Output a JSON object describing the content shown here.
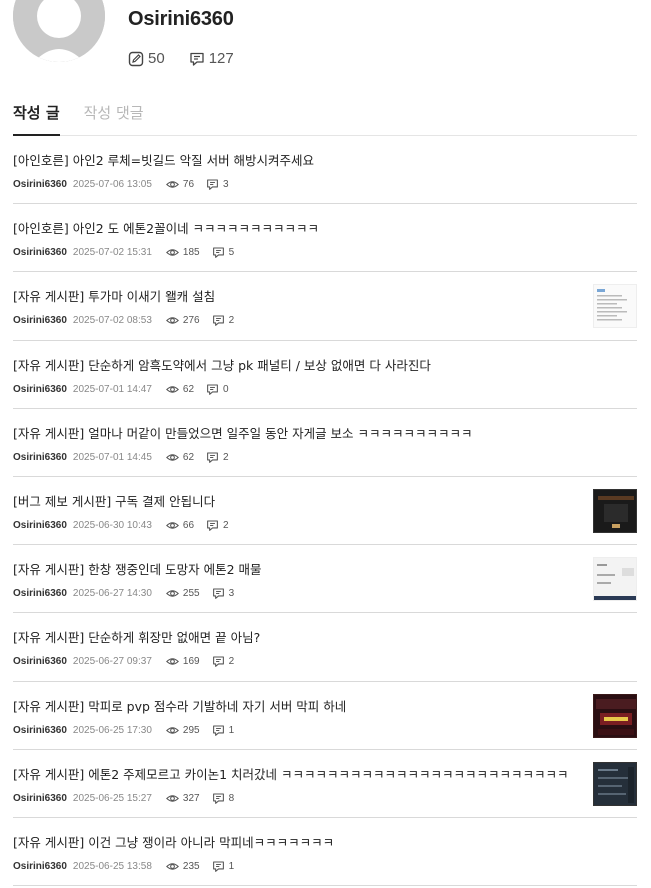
{
  "profile": {
    "username": "Osirini6360",
    "post_count": "50",
    "comment_count": "127"
  },
  "tabs": [
    {
      "label": "작성 글",
      "active": true
    },
    {
      "label": "작성 댓글",
      "active": false
    }
  ],
  "posts": [
    {
      "title": "[아인호른] 아인2 루체=빗길드 악질 서버 해방시켜주세요",
      "author": "Osirini6360",
      "date": "2025-07-06 13:05",
      "views": "76",
      "comments": "3",
      "thumb": "none"
    },
    {
      "title": "[아인호른] 아인2 도 에톤2꼴이네 ㅋㅋㅋㅋㅋㅋㅋㅋㅋㅋㅋ",
      "author": "Osirini6360",
      "date": "2025-07-02 15:31",
      "views": "185",
      "comments": "5",
      "thumb": "none"
    },
    {
      "title": "[자유 게시판] 투가마 이새기 왤캐 설침",
      "author": "Osirini6360",
      "date": "2025-07-02 08:53",
      "views": "276",
      "comments": "2",
      "thumb": "doc"
    },
    {
      "title": "[자유 게시판] 단순하게 암흑도약에서 그냥 pk 패널티 / 보상 없애면 다 사라진다",
      "author": "Osirini6360",
      "date": "2025-07-01 14:47",
      "views": "62",
      "comments": "0",
      "thumb": "none"
    },
    {
      "title": "[자유 게시판] 얼마나 머같이 만들었으면 일주일 동안 자게글 보소 ㅋㅋㅋㅋㅋㅋㅋㅋㅋㅋ",
      "author": "Osirini6360",
      "date": "2025-07-01 14:45",
      "views": "62",
      "comments": "2",
      "thumb": "none"
    },
    {
      "title": "[버그 제보 게시판] 구독 결제 안됩니다",
      "author": "Osirini6360",
      "date": "2025-06-30 10:43",
      "views": "66",
      "comments": "2",
      "thumb": "dark"
    },
    {
      "title": "[자유 게시판] 한창 쟁중인데 도망자 에톤2 매물",
      "author": "Osirini6360",
      "date": "2025-06-27 14:30",
      "views": "255",
      "comments": "3",
      "thumb": "ui"
    },
    {
      "title": "[자유 게시판] 단순하게 휘장만 없애면 끝 아님?",
      "author": "Osirini6360",
      "date": "2025-06-27 09:37",
      "views": "169",
      "comments": "2",
      "thumb": "none"
    },
    {
      "title": "[자유 게시판] 막피로 pvp 점수라 기발하네 자기 서버 막피 하네",
      "author": "Osirini6360",
      "date": "2025-06-25 17:30",
      "views": "295",
      "comments": "1",
      "thumb": "poster"
    },
    {
      "title": "[자유 게시판] 에톤2 주제모르고 카이논1 치러갔네 ㅋㅋㅋㅋㅋㅋㅋㅋㅋㅋㅋㅋㅋㅋㅋㅋㅋㅋㅋㅋㅋㅋㅋㅋㅋ",
      "author": "Osirini6360",
      "date": "2025-06-25 15:27",
      "views": "327",
      "comments": "8",
      "thumb": "darkui"
    },
    {
      "title": "[자유 게시판] 이건 그냥 쟁이라 아니라 막피네ㅋㅋㅋㅋㅋㅋㅋ",
      "author": "Osirini6360",
      "date": "2025-06-25 13:58",
      "views": "235",
      "comments": "1",
      "thumb": "none"
    }
  ]
}
